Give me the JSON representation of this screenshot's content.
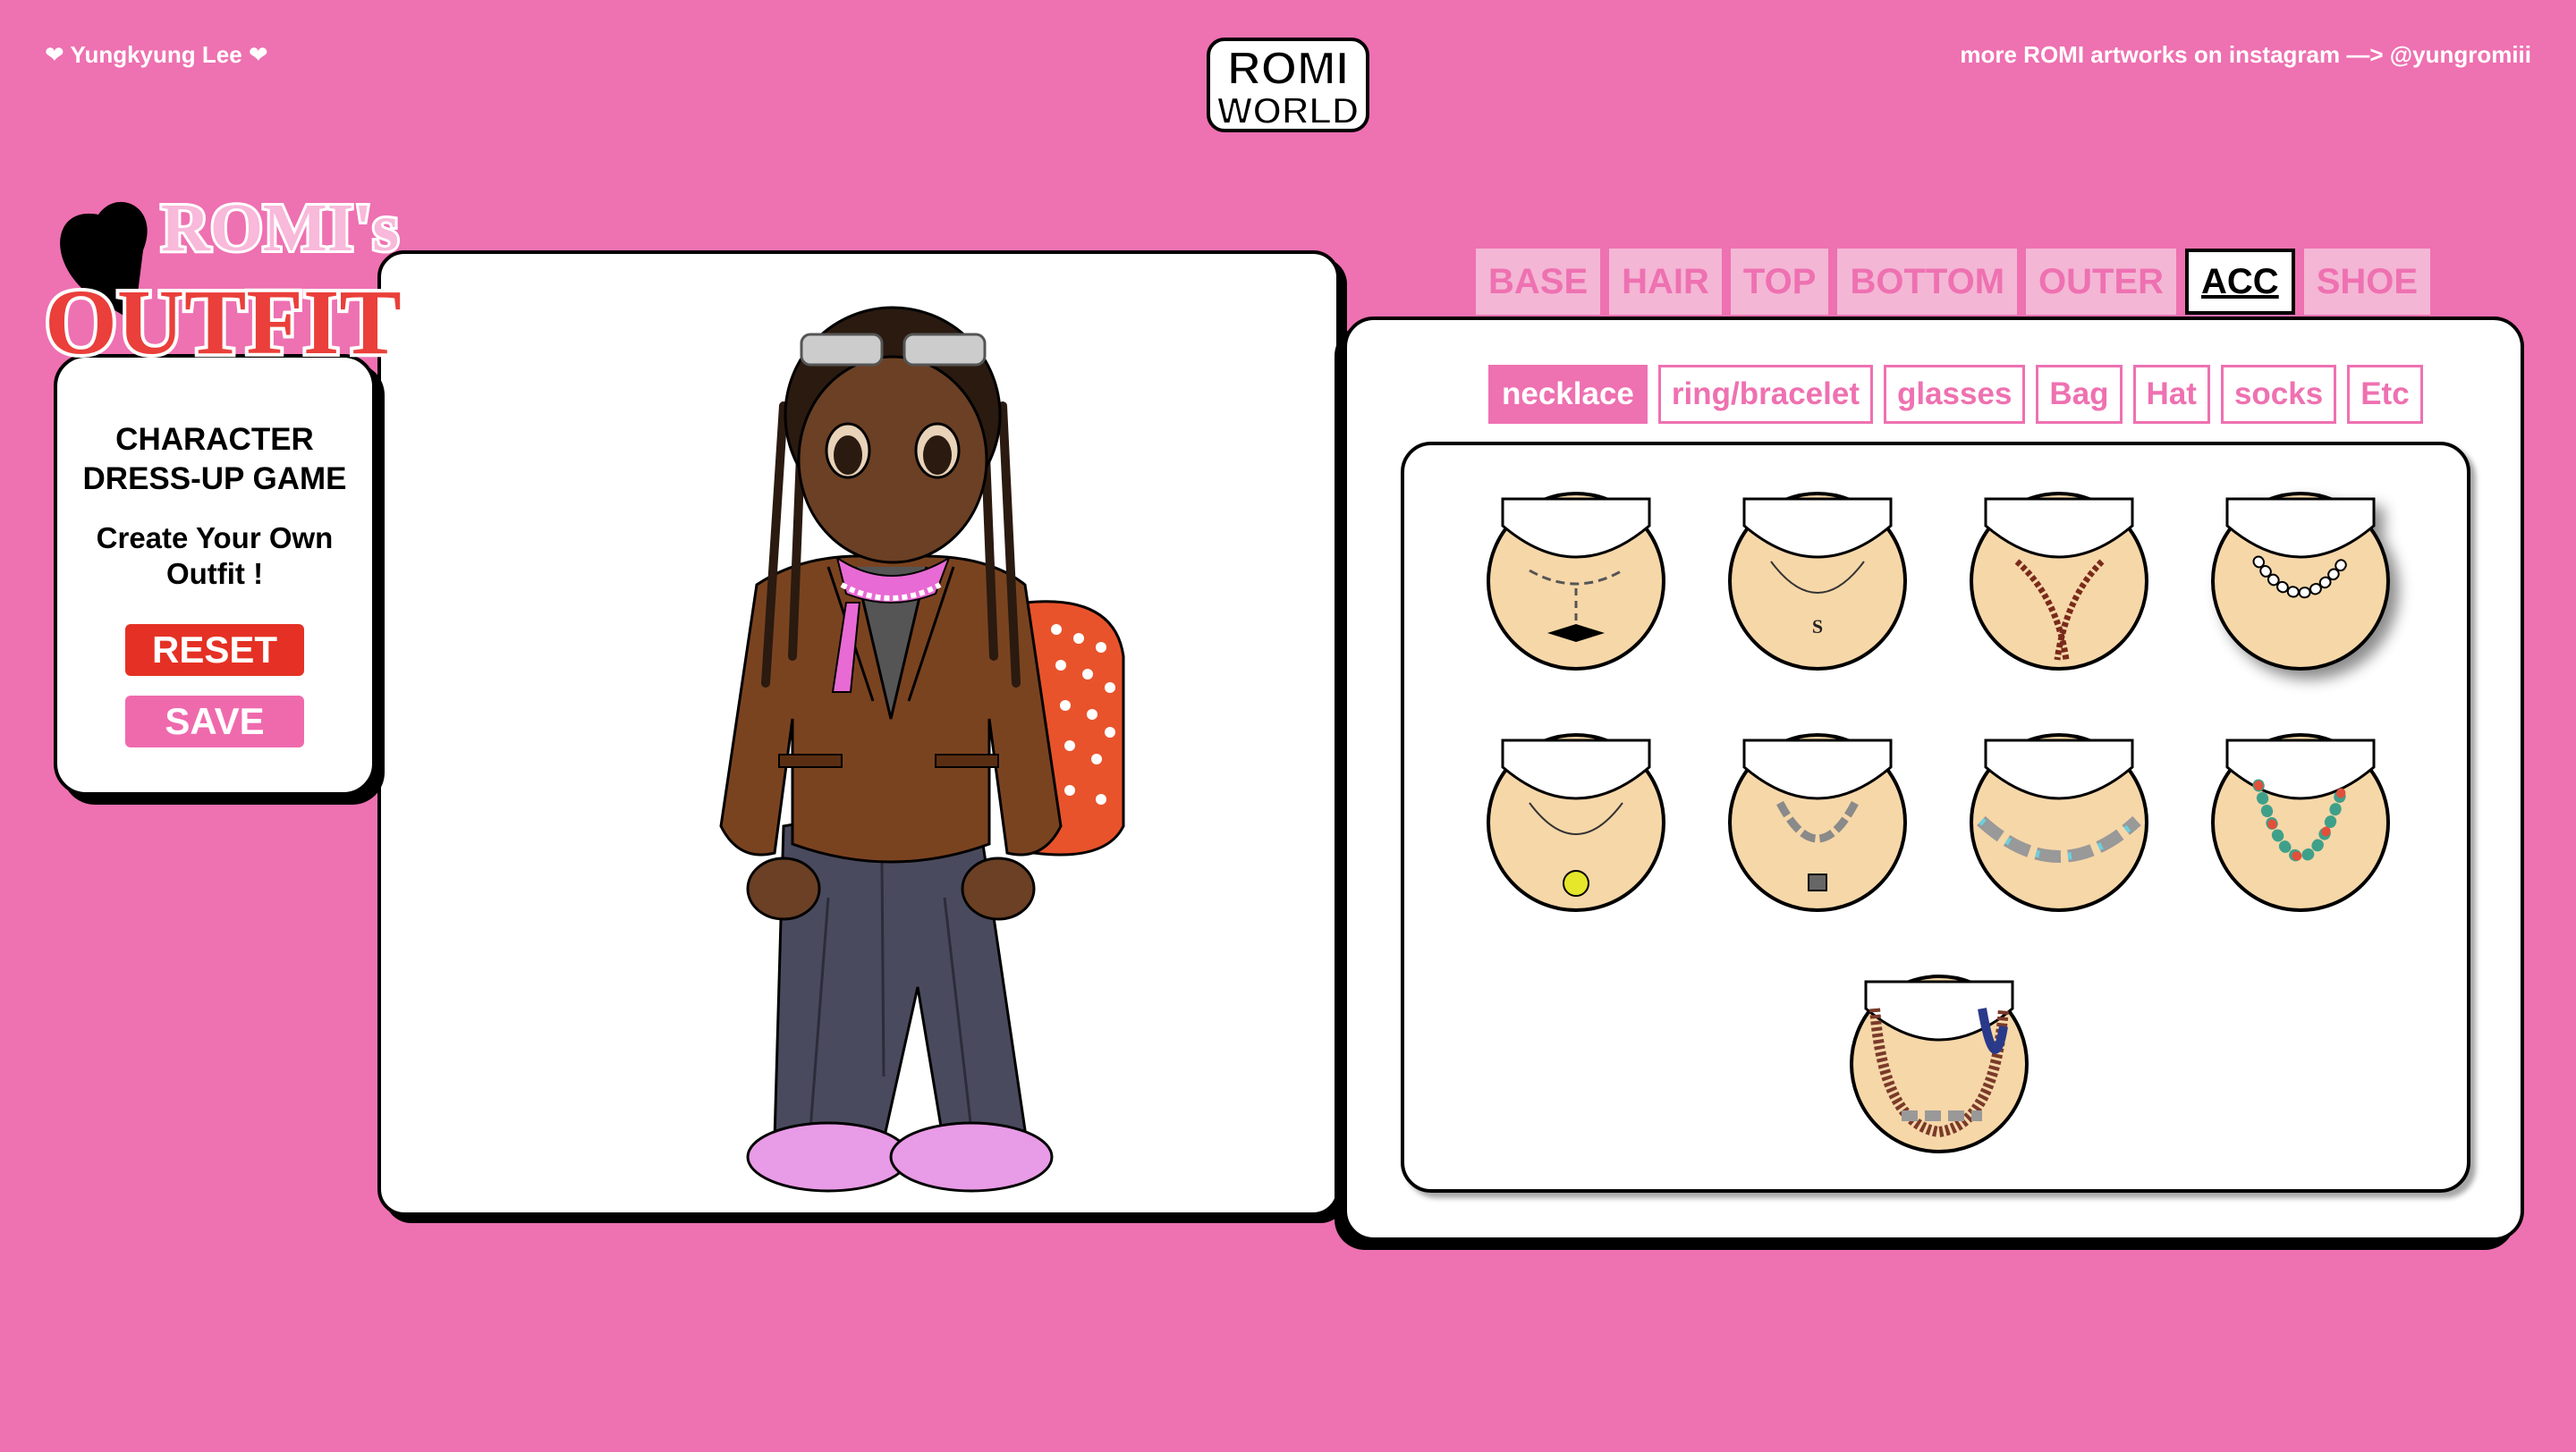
{
  "header": {
    "author": "❤ Yungkyung Lee ❤",
    "instagram": "more ROMI artworks on instagram —> @yungromiii",
    "logo_top": "ROMI",
    "logo_bottom": "WORLD"
  },
  "title_logo": {
    "line1": "ROMI's",
    "line2": "OUTFIT"
  },
  "info": {
    "title_line1": "CHARACTER",
    "title_line2": "DRESS-UP GAME",
    "sub_line1": "Create Your Own",
    "sub_line2": "Outfit !",
    "reset_label": "RESET",
    "save_label": "SAVE"
  },
  "tabs": [
    {
      "label": "BASE"
    },
    {
      "label": "HAIR"
    },
    {
      "label": "TOP"
    },
    {
      "label": "BOTTOM"
    },
    {
      "label": "OUTER"
    },
    {
      "label": "ACC",
      "active": true
    },
    {
      "label": "SHOE"
    }
  ],
  "subtabs": [
    {
      "label": "necklace",
      "active": true
    },
    {
      "label": "ring/bracelet"
    },
    {
      "label": "glasses"
    },
    {
      "label": "Bag"
    },
    {
      "label": "Hat"
    },
    {
      "label": "socks"
    },
    {
      "label": "Etc"
    }
  ],
  "items": [
    {
      "name": "pearl-bow-necklace",
      "color": "#ffffff"
    },
    {
      "name": "chain-s-pendant-necklace",
      "color": "#333333"
    },
    {
      "name": "brown-bead-knot-necklace",
      "color": "#7a2a1a"
    },
    {
      "name": "pearl-necklace",
      "color": "#ffffff"
    },
    {
      "name": "orb-pendant-necklace",
      "color": "#e6e62a"
    },
    {
      "name": "padlock-chain-necklace",
      "color": "#8a8a8a"
    },
    {
      "name": "silver-bead-necklace",
      "color": "#6ad0e0"
    },
    {
      "name": "multicolor-bead-necklace",
      "color": "#3fa08a"
    },
    {
      "name": "beaded-cord-necklace",
      "color": "#2a3a8a"
    }
  ],
  "colors": {
    "background": "#ee71b1",
    "accent_red": "#e53125",
    "tab_inactive_bg": "#f4b6d5",
    "skin": "#f6d7a8"
  }
}
